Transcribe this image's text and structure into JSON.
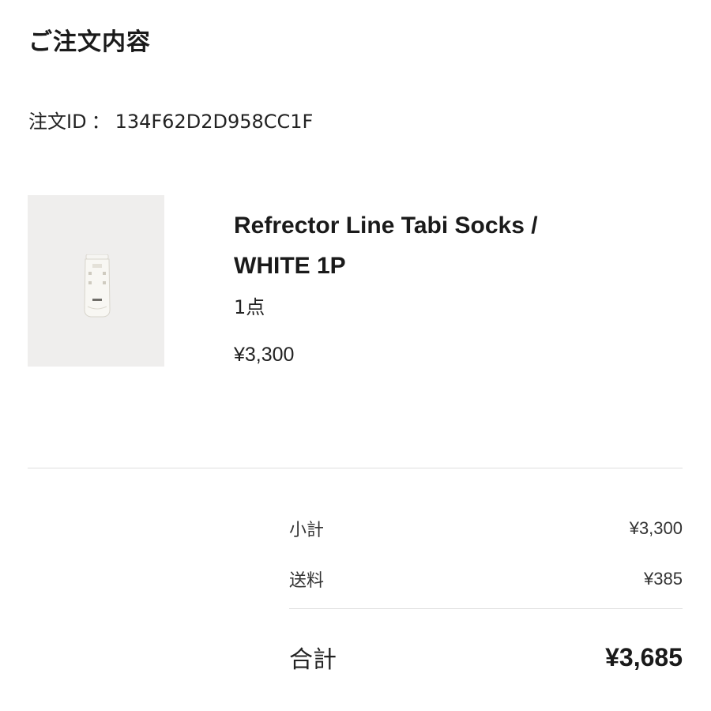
{
  "page": {
    "title": "ご注文内容"
  },
  "order": {
    "id_label": "注文ID",
    "id_separator": "：",
    "id_value": "134F62D2D958CC1F"
  },
  "item": {
    "name_line1": "Refrector Line Tabi Socks /",
    "name_line2": "WHITE 1P",
    "quantity": "1点",
    "price": "¥3,300",
    "image_icon": "sock-package-icon"
  },
  "summary": {
    "subtotal_label": "小計",
    "subtotal_value": "¥3,300",
    "shipping_label": "送料",
    "shipping_value": "¥385",
    "total_label": "合計",
    "total_value": "¥3,685"
  },
  "colors": {
    "text_primary": "#1a1a1a",
    "divider": "#dedede",
    "thumb_background": "#efeeed"
  }
}
